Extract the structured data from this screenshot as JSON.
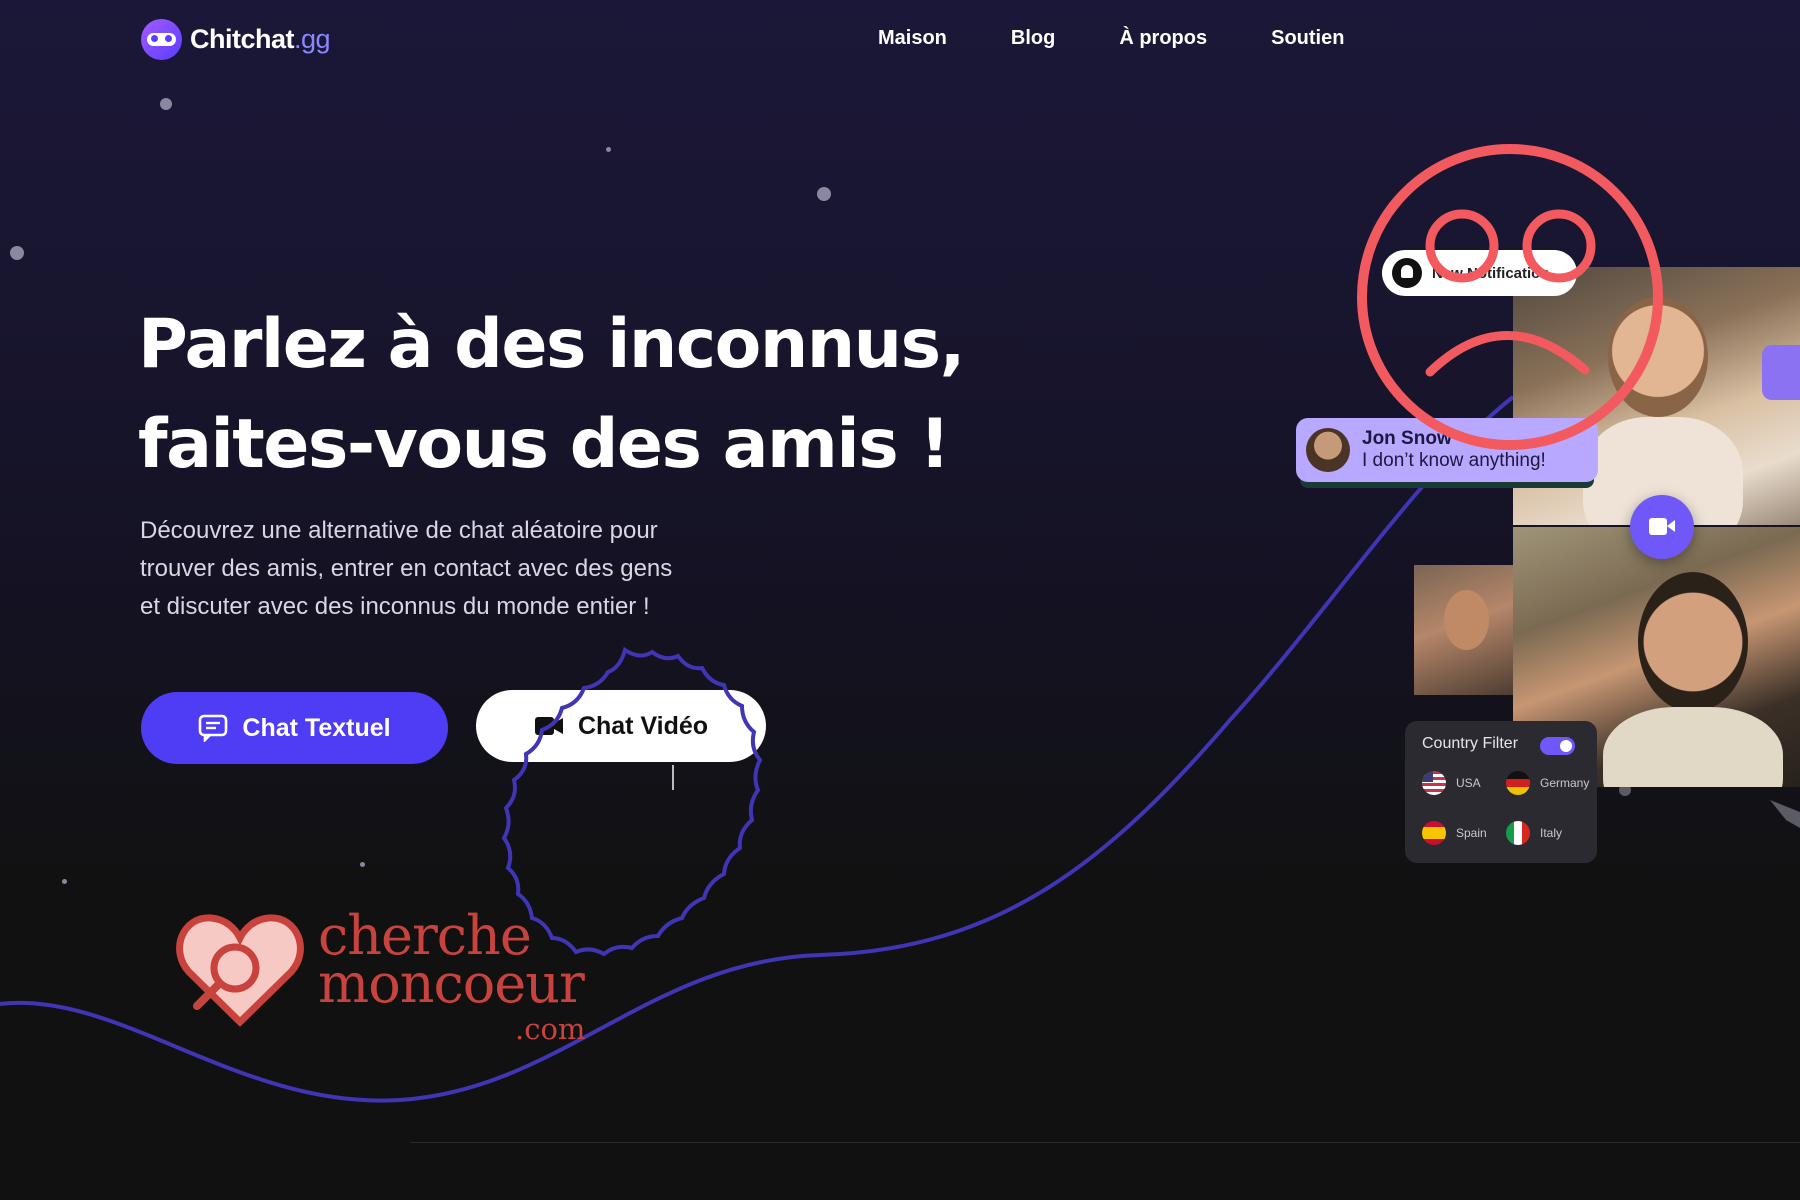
{
  "brand": {
    "name": "Chitchat",
    "suffix": ".gg"
  },
  "nav": {
    "items": [
      "Maison",
      "Blog",
      "À propos",
      "Soutien"
    ]
  },
  "hero": {
    "title_lines": [
      "Parlez à des inconnus,",
      "faites-vous des amis !"
    ],
    "subtitle_lines": [
      "Découvrez une alternative de chat aléatoire pour",
      "trouver des amis, entrer en contact avec des gens",
      "et discuter avec des inconnus du monde entier !"
    ]
  },
  "buttons": {
    "text_chat": "Chat Textuel",
    "video_chat": "Chat Vidéo"
  },
  "mockup": {
    "notification": "New Notification",
    "chat_bubble": {
      "name": "Jon Snow",
      "message": "I don’t know anything!"
    },
    "country_filter": {
      "title": "Country Filter",
      "enabled": true,
      "countries": [
        "USA",
        "Germany",
        "Spain",
        "Italy"
      ]
    }
  },
  "watermark": {
    "line1": "cherche",
    "line2": "moncoeur",
    "domain": ".com"
  },
  "colors": {
    "background_top": "#1b1738",
    "background_bottom": "#111111",
    "accent": "#4f3cf5",
    "secondary_accent": "#6f57f8",
    "annotation_red": "#f25a5f",
    "watermark_red": "#c8433d",
    "curve": "#3f35b5"
  },
  "icons": [
    "chitchat-logo-icon",
    "chat-bubble-icon",
    "video-camera-icon",
    "bell-icon",
    "sad-face-icon",
    "heart-search-icon"
  ]
}
